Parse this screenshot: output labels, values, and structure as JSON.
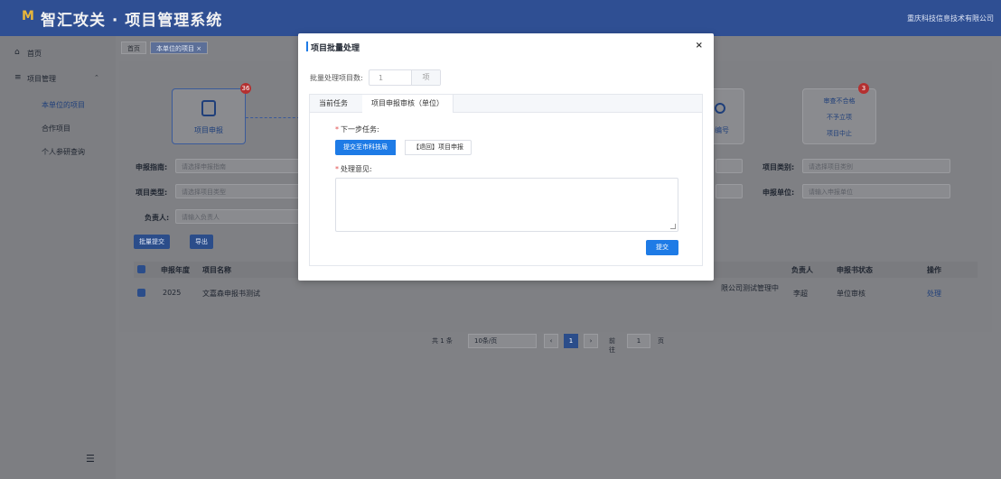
{
  "header": {
    "logo": "M",
    "title": "智汇攻关 · 项目管理系统",
    "org": "重庆科技信息技术有限公司"
  },
  "sidebar": {
    "home": "首页",
    "project_mgmt": "项目管理",
    "sub_items": [
      "本单位的项目",
      "合作项目",
      "个人参研查询"
    ]
  },
  "tabs": [
    "首页",
    "本单位的项目 ×"
  ],
  "steps": {
    "step1": "项目申报",
    "step1_badge": "36",
    "step2_tail": "编号"
  },
  "right_box": {
    "item1": "审查不合格",
    "item1_badge": "3",
    "item2": "不予立项",
    "item3": "项目中止"
  },
  "filters": {
    "guide_label": "申报指南:",
    "guide_ph": "请选择申报指南",
    "type_label": "项目类型:",
    "type_ph": "请选择项目类型",
    "owner_label": "负责人:",
    "owner_ph": "请输入负责人",
    "category_label": "项目类别:",
    "category_ph": "请选择项目类别",
    "unit_label": "申报单位:",
    "unit_ph": "请输入申报单位"
  },
  "actions": {
    "batch_submit": "批量提交",
    "export": "导出"
  },
  "table": {
    "headers": {
      "year": "申报年度",
      "name": "项目名称",
      "owner": "负责人",
      "status": "申报书状态",
      "op": "操作"
    },
    "row": {
      "year": "2025",
      "name": "文嘉森申报书测试",
      "org_tail": "限公司测试管理中",
      "owner": "李超",
      "status": "单位审核",
      "op": "处理"
    }
  },
  "pager": {
    "total": "共 1 条",
    "size": "10条/页",
    "page": "1",
    "goto": "前往",
    "goto_val": "1",
    "page_unit": "页"
  },
  "modal": {
    "title": "项目批量处理",
    "close": "×",
    "count_label": "批量处理项目数:",
    "count_value": "1",
    "count_unit": "项",
    "tabs": [
      "当前任务",
      "项目申报审核（单位）"
    ],
    "next_task_label": "下一步任务:",
    "next_options": [
      "提交至市科技局",
      "【退回】项目申报"
    ],
    "opinion_label": "处理意见:",
    "submit": "提交"
  }
}
